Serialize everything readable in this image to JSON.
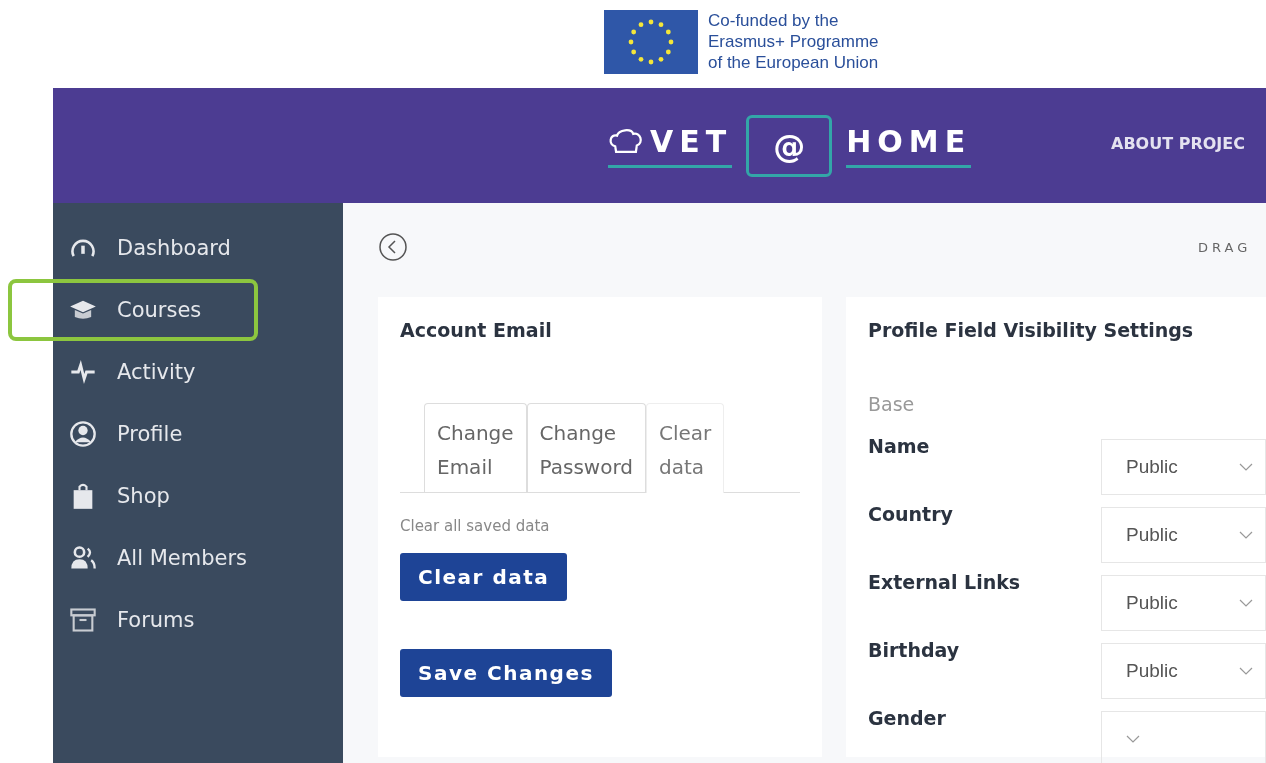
{
  "funding": {
    "lines": [
      "Co-funded by the",
      "Erasmus+ Programme",
      "of the European Union"
    ]
  },
  "logo": {
    "left": "VET",
    "middle": "@",
    "right": "HOME"
  },
  "nav": [
    "ABOUT PROJEC"
  ],
  "sidebar": {
    "items": [
      {
        "label": "Dashboard",
        "kind": "gauge",
        "highlighted": false
      },
      {
        "label": "Courses",
        "kind": "cap",
        "highlighted": true
      },
      {
        "label": "Activity",
        "kind": "pulse",
        "highlighted": false
      },
      {
        "label": "Profile",
        "kind": "user",
        "highlighted": false
      },
      {
        "label": "Shop",
        "kind": "bag",
        "highlighted": false
      },
      {
        "label": "All Members",
        "kind": "members",
        "highlighted": false
      },
      {
        "label": "Forums",
        "kind": "archive",
        "highlighted": false
      }
    ]
  },
  "toolbar": {
    "hint": "DRAG"
  },
  "account": {
    "title": "Account Email",
    "tabs": [
      {
        "lines": [
          "Change",
          "Email"
        ],
        "selected": false
      },
      {
        "lines": [
          "Change",
          "Password"
        ],
        "selected": false
      },
      {
        "lines": [
          "Clear",
          "data"
        ],
        "selected": true
      }
    ],
    "description": "Clear all saved data",
    "buttons": [
      "Clear data",
      "Save Changes"
    ]
  },
  "visibility": {
    "title": "Profile Field Visibility Settings",
    "group": "Base",
    "fields": [
      {
        "label": "Name",
        "value": "Public"
      },
      {
        "label": "Country",
        "value": "Public"
      },
      {
        "label": "External Links",
        "value": "Public"
      },
      {
        "label": "Birthday",
        "value": "Public"
      },
      {
        "label": "Gender"
      }
    ]
  }
}
